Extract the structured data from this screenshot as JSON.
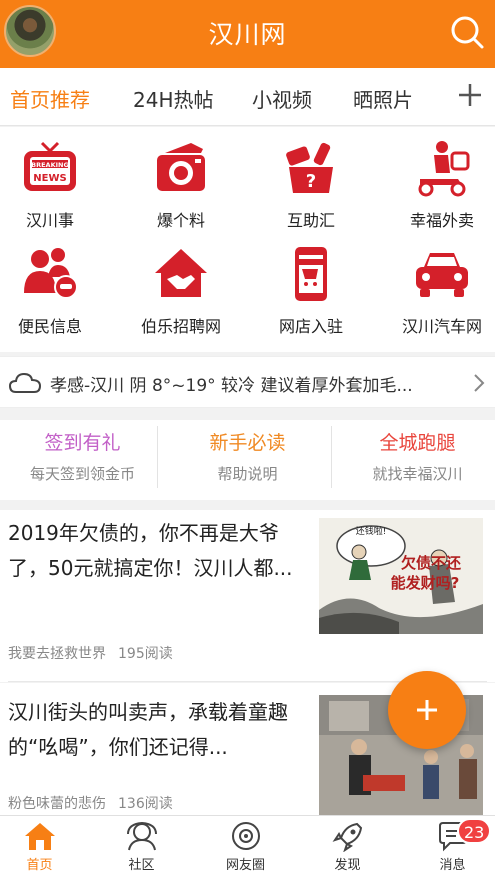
{
  "header": {
    "title": "汉川网"
  },
  "tabs": [
    {
      "label": "首页推荐"
    },
    {
      "label": "24H热帖"
    },
    {
      "label": "小视频"
    },
    {
      "label": "晒照片"
    }
  ],
  "grid": [
    {
      "label": "汉川事",
      "icon": "breaking-news-icon"
    },
    {
      "label": "爆个料",
      "icon": "camera-icon"
    },
    {
      "label": "互助汇",
      "icon": "help-box-icon"
    },
    {
      "label": "幸福外卖",
      "icon": "delivery-scooter-icon"
    },
    {
      "label": "便民信息",
      "icon": "people-car-icon"
    },
    {
      "label": "伯乐招聘网",
      "icon": "handshake-house-icon"
    },
    {
      "label": "网店入驻",
      "icon": "phone-cart-icon"
    },
    {
      "label": "汉川汽车网",
      "icon": "car-icon"
    }
  ],
  "weather": {
    "text": "孝感-汉川 阴 8°~19° 较冷 建议着厚外套加毛..."
  },
  "quick": [
    {
      "title": "签到有礼",
      "sub": "每天签到领金币",
      "color": "#c25fc7"
    },
    {
      "title": "新手必读",
      "sub": "帮助说明",
      "color": "#f08a24"
    },
    {
      "title": "全城跑腿",
      "sub": "就找幸福汉川",
      "color": "#e9453c"
    }
  ],
  "articles": [
    {
      "title": "2019年欠债的，你不再是大爷了，50元就搞定你！汉川人都...",
      "author": "我要去拯救世界",
      "reads": "195阅读",
      "image_text_1": "欠债不还",
      "image_text_2": "能发财吗?",
      "image_bubble": "还钱啦!"
    },
    {
      "title": "汉川街头的叫卖声，承载着童趣的“吆喝”，你们还记得...",
      "author": "粉色味蕾的悲伤",
      "reads": "136阅读"
    }
  ],
  "bottom_nav": [
    {
      "label": "首页"
    },
    {
      "label": "社区"
    },
    {
      "label": "网友圈"
    },
    {
      "label": "发现"
    },
    {
      "label": "消息"
    }
  ],
  "badge": "23",
  "colors": {
    "accent": "#f77f14",
    "icon_red": "#d4202a"
  }
}
